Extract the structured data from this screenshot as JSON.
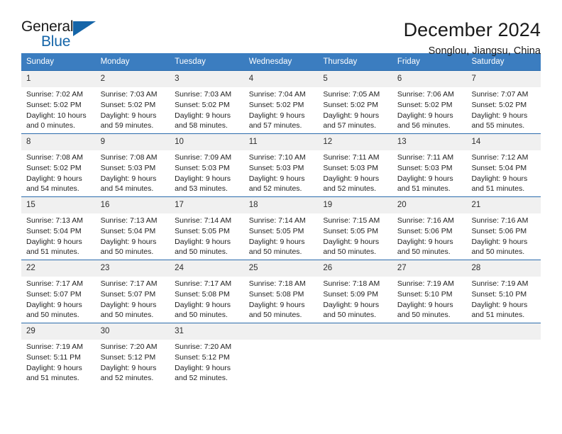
{
  "brand": {
    "name_top": "General",
    "name_bottom": "Blue",
    "triangle_icon": "blue-triangle-logo-icon",
    "accent_color": "#1565a8"
  },
  "header": {
    "title": "December 2024",
    "subtitle": "Songlou, Jiangsu, China"
  },
  "colors": {
    "header_row_bg": "#3b7dc0",
    "week_divider": "#2b6cad",
    "daynum_band_bg": "#f0f0f0",
    "text": "#1a1a1a"
  },
  "weekday_headers": [
    "Sunday",
    "Monday",
    "Tuesday",
    "Wednesday",
    "Thursday",
    "Friday",
    "Saturday"
  ],
  "weeks": [
    {
      "numbers": [
        "1",
        "2",
        "3",
        "4",
        "5",
        "6",
        "7"
      ],
      "days": [
        {
          "sunrise": "Sunrise: 7:02 AM",
          "sunset": "Sunset: 5:02 PM",
          "daylight1": "Daylight: 10 hours",
          "daylight2": "and 0 minutes."
        },
        {
          "sunrise": "Sunrise: 7:03 AM",
          "sunset": "Sunset: 5:02 PM",
          "daylight1": "Daylight: 9 hours",
          "daylight2": "and 59 minutes."
        },
        {
          "sunrise": "Sunrise: 7:03 AM",
          "sunset": "Sunset: 5:02 PM",
          "daylight1": "Daylight: 9 hours",
          "daylight2": "and 58 minutes."
        },
        {
          "sunrise": "Sunrise: 7:04 AM",
          "sunset": "Sunset: 5:02 PM",
          "daylight1": "Daylight: 9 hours",
          "daylight2": "and 57 minutes."
        },
        {
          "sunrise": "Sunrise: 7:05 AM",
          "sunset": "Sunset: 5:02 PM",
          "daylight1": "Daylight: 9 hours",
          "daylight2": "and 57 minutes."
        },
        {
          "sunrise": "Sunrise: 7:06 AM",
          "sunset": "Sunset: 5:02 PM",
          "daylight1": "Daylight: 9 hours",
          "daylight2": "and 56 minutes."
        },
        {
          "sunrise": "Sunrise: 7:07 AM",
          "sunset": "Sunset: 5:02 PM",
          "daylight1": "Daylight: 9 hours",
          "daylight2": "and 55 minutes."
        }
      ]
    },
    {
      "numbers": [
        "8",
        "9",
        "10",
        "11",
        "12",
        "13",
        "14"
      ],
      "days": [
        {
          "sunrise": "Sunrise: 7:08 AM",
          "sunset": "Sunset: 5:02 PM",
          "daylight1": "Daylight: 9 hours",
          "daylight2": "and 54 minutes."
        },
        {
          "sunrise": "Sunrise: 7:08 AM",
          "sunset": "Sunset: 5:03 PM",
          "daylight1": "Daylight: 9 hours",
          "daylight2": "and 54 minutes."
        },
        {
          "sunrise": "Sunrise: 7:09 AM",
          "sunset": "Sunset: 5:03 PM",
          "daylight1": "Daylight: 9 hours",
          "daylight2": "and 53 minutes."
        },
        {
          "sunrise": "Sunrise: 7:10 AM",
          "sunset": "Sunset: 5:03 PM",
          "daylight1": "Daylight: 9 hours",
          "daylight2": "and 52 minutes."
        },
        {
          "sunrise": "Sunrise: 7:11 AM",
          "sunset": "Sunset: 5:03 PM",
          "daylight1": "Daylight: 9 hours",
          "daylight2": "and 52 minutes."
        },
        {
          "sunrise": "Sunrise: 7:11 AM",
          "sunset": "Sunset: 5:03 PM",
          "daylight1": "Daylight: 9 hours",
          "daylight2": "and 51 minutes."
        },
        {
          "sunrise": "Sunrise: 7:12 AM",
          "sunset": "Sunset: 5:04 PM",
          "daylight1": "Daylight: 9 hours",
          "daylight2": "and 51 minutes."
        }
      ]
    },
    {
      "numbers": [
        "15",
        "16",
        "17",
        "18",
        "19",
        "20",
        "21"
      ],
      "days": [
        {
          "sunrise": "Sunrise: 7:13 AM",
          "sunset": "Sunset: 5:04 PM",
          "daylight1": "Daylight: 9 hours",
          "daylight2": "and 51 minutes."
        },
        {
          "sunrise": "Sunrise: 7:13 AM",
          "sunset": "Sunset: 5:04 PM",
          "daylight1": "Daylight: 9 hours",
          "daylight2": "and 50 minutes."
        },
        {
          "sunrise": "Sunrise: 7:14 AM",
          "sunset": "Sunset: 5:05 PM",
          "daylight1": "Daylight: 9 hours",
          "daylight2": "and 50 minutes."
        },
        {
          "sunrise": "Sunrise: 7:14 AM",
          "sunset": "Sunset: 5:05 PM",
          "daylight1": "Daylight: 9 hours",
          "daylight2": "and 50 minutes."
        },
        {
          "sunrise": "Sunrise: 7:15 AM",
          "sunset": "Sunset: 5:05 PM",
          "daylight1": "Daylight: 9 hours",
          "daylight2": "and 50 minutes."
        },
        {
          "sunrise": "Sunrise: 7:16 AM",
          "sunset": "Sunset: 5:06 PM",
          "daylight1": "Daylight: 9 hours",
          "daylight2": "and 50 minutes."
        },
        {
          "sunrise": "Sunrise: 7:16 AM",
          "sunset": "Sunset: 5:06 PM",
          "daylight1": "Daylight: 9 hours",
          "daylight2": "and 50 minutes."
        }
      ]
    },
    {
      "numbers": [
        "22",
        "23",
        "24",
        "25",
        "26",
        "27",
        "28"
      ],
      "days": [
        {
          "sunrise": "Sunrise: 7:17 AM",
          "sunset": "Sunset: 5:07 PM",
          "daylight1": "Daylight: 9 hours",
          "daylight2": "and 50 minutes."
        },
        {
          "sunrise": "Sunrise: 7:17 AM",
          "sunset": "Sunset: 5:07 PM",
          "daylight1": "Daylight: 9 hours",
          "daylight2": "and 50 minutes."
        },
        {
          "sunrise": "Sunrise: 7:17 AM",
          "sunset": "Sunset: 5:08 PM",
          "daylight1": "Daylight: 9 hours",
          "daylight2": "and 50 minutes."
        },
        {
          "sunrise": "Sunrise: 7:18 AM",
          "sunset": "Sunset: 5:08 PM",
          "daylight1": "Daylight: 9 hours",
          "daylight2": "and 50 minutes."
        },
        {
          "sunrise": "Sunrise: 7:18 AM",
          "sunset": "Sunset: 5:09 PM",
          "daylight1": "Daylight: 9 hours",
          "daylight2": "and 50 minutes."
        },
        {
          "sunrise": "Sunrise: 7:19 AM",
          "sunset": "Sunset: 5:10 PM",
          "daylight1": "Daylight: 9 hours",
          "daylight2": "and 50 minutes."
        },
        {
          "sunrise": "Sunrise: 7:19 AM",
          "sunset": "Sunset: 5:10 PM",
          "daylight1": "Daylight: 9 hours",
          "daylight2": "and 51 minutes."
        }
      ]
    },
    {
      "numbers": [
        "29",
        "30",
        "31",
        "",
        "",
        "",
        ""
      ],
      "days": [
        {
          "sunrise": "Sunrise: 7:19 AM",
          "sunset": "Sunset: 5:11 PM",
          "daylight1": "Daylight: 9 hours",
          "daylight2": "and 51 minutes."
        },
        {
          "sunrise": "Sunrise: 7:20 AM",
          "sunset": "Sunset: 5:12 PM",
          "daylight1": "Daylight: 9 hours",
          "daylight2": "and 52 minutes."
        },
        {
          "sunrise": "Sunrise: 7:20 AM",
          "sunset": "Sunset: 5:12 PM",
          "daylight1": "Daylight: 9 hours",
          "daylight2": "and 52 minutes."
        },
        {
          "sunrise": "",
          "sunset": "",
          "daylight1": "",
          "daylight2": ""
        },
        {
          "sunrise": "",
          "sunset": "",
          "daylight1": "",
          "daylight2": ""
        },
        {
          "sunrise": "",
          "sunset": "",
          "daylight1": "",
          "daylight2": ""
        },
        {
          "sunrise": "",
          "sunset": "",
          "daylight1": "",
          "daylight2": ""
        }
      ]
    }
  ]
}
